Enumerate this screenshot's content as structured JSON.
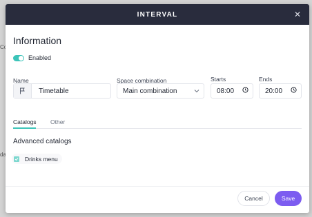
{
  "modal": {
    "title": "INTERVAL",
    "close_icon": "close-icon"
  },
  "information": {
    "title": "Information",
    "toggle": {
      "label": "Enabled",
      "on": true,
      "color": "#3cc4b9"
    }
  },
  "fields": {
    "name": {
      "label": "Name",
      "value": "Timetable",
      "icon": "flag-icon"
    },
    "space": {
      "label": "Space combination",
      "value": "Main combination",
      "icon": "chevron-down-icon"
    },
    "starts": {
      "label": "Starts",
      "value": "08:00",
      "icon": "clock-icon"
    },
    "ends": {
      "label": "Ends",
      "value": "20:00",
      "icon": "clock-icon"
    }
  },
  "tabs": [
    {
      "label": "Catalogs",
      "active": true
    },
    {
      "label": "Other",
      "active": false
    }
  ],
  "catalogs": {
    "title": "Advanced catalogs",
    "items": [
      {
        "label": "Drinks menu",
        "checked": true
      }
    ]
  },
  "footer": {
    "cancel_label": "Cancel",
    "save_label": "Save"
  },
  "background": {
    "edge_text_1": "Co",
    "edge_text_2": "da"
  },
  "colors": {
    "header": "#292c3d",
    "accent": "#3cc4b9",
    "primary": "#7c5cf0"
  }
}
